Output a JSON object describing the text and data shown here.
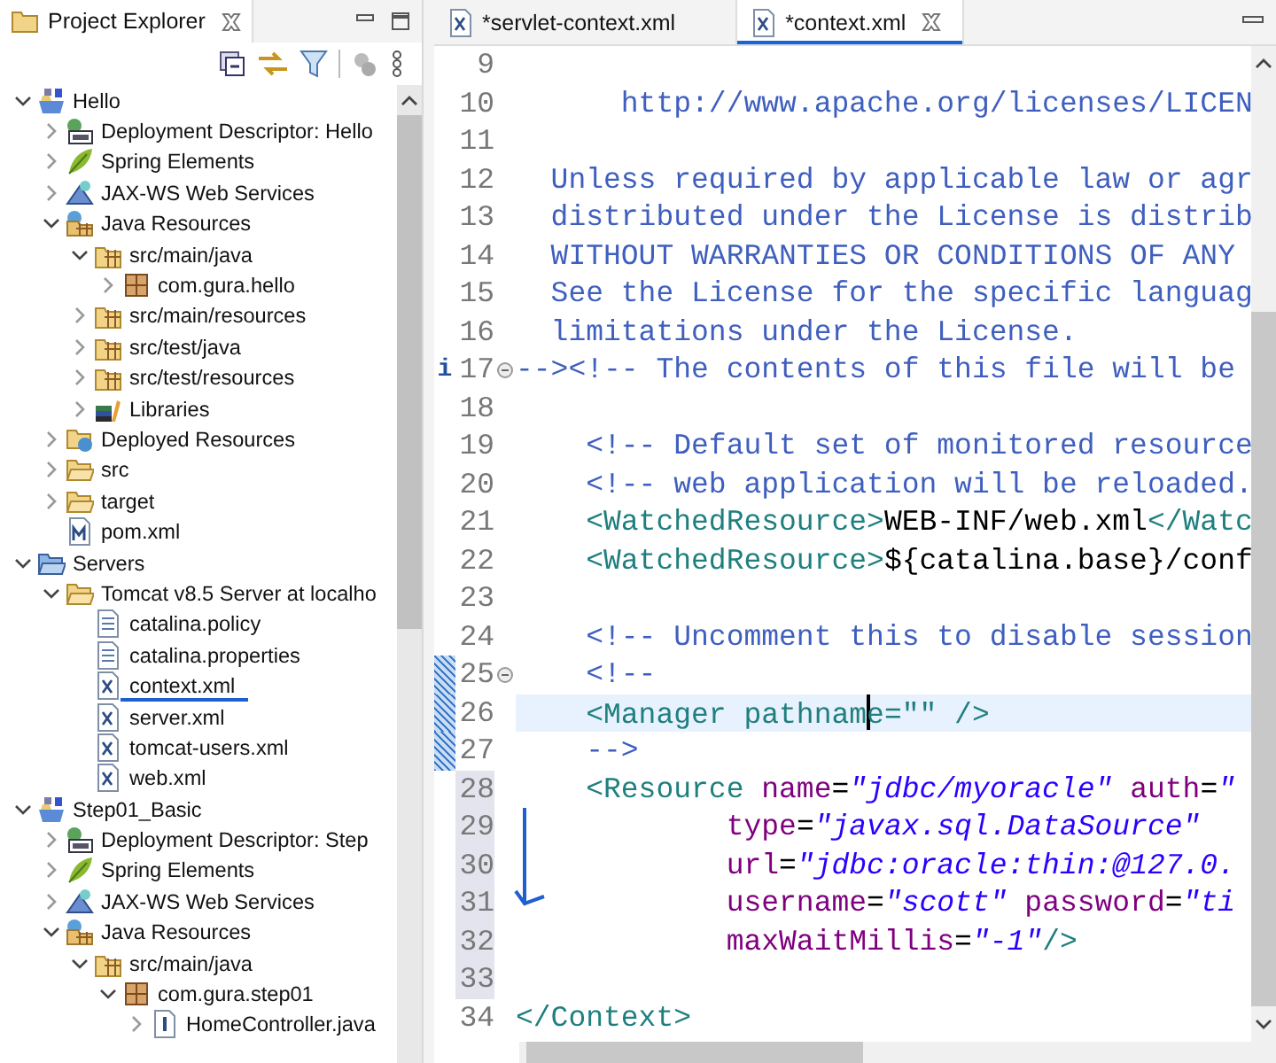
{
  "explorer": {
    "title": "Project Explorer",
    "tree": [
      {
        "label": "Hello",
        "kind": "project",
        "expanded": true,
        "children": [
          {
            "label": "Deployment Descriptor: Hello",
            "kind": "descriptor",
            "expanded": false
          },
          {
            "label": "Spring Elements",
            "kind": "spring",
            "expanded": false
          },
          {
            "label": "JAX-WS Web Services",
            "kind": "webservices",
            "expanded": false
          },
          {
            "label": "Java Resources",
            "kind": "java-resources",
            "expanded": true,
            "children": [
              {
                "label": "src/main/java",
                "kind": "source-folder",
                "expanded": true,
                "children": [
                  {
                    "label": "com.gura.hello",
                    "kind": "package",
                    "expanded": false
                  }
                ]
              },
              {
                "label": "src/main/resources",
                "kind": "source-folder",
                "expanded": false
              },
              {
                "label": "src/test/java",
                "kind": "source-folder",
                "expanded": false
              },
              {
                "label": "src/test/resources",
                "kind": "source-folder",
                "expanded": false
              },
              {
                "label": "Libraries",
                "kind": "libraries",
                "expanded": false
              }
            ]
          },
          {
            "label": "Deployed Resources",
            "kind": "deployed",
            "expanded": false
          },
          {
            "label": "src",
            "kind": "folder",
            "expanded": false
          },
          {
            "label": "target",
            "kind": "folder",
            "expanded": false
          },
          {
            "label": "pom.xml",
            "kind": "maven"
          }
        ]
      },
      {
        "label": "Servers",
        "kind": "servers",
        "expanded": true,
        "children": [
          {
            "label": "Tomcat v8.5 Server at localho",
            "kind": "folder",
            "expanded": true,
            "children": [
              {
                "label": "catalina.policy",
                "kind": "text-file"
              },
              {
                "label": "catalina.properties",
                "kind": "text-file"
              },
              {
                "label": "context.xml",
                "kind": "xml-file",
                "underlined": true
              },
              {
                "label": "server.xml",
                "kind": "xml-file"
              },
              {
                "label": "tomcat-users.xml",
                "kind": "xml-file"
              },
              {
                "label": "web.xml",
                "kind": "xml-file"
              }
            ]
          }
        ]
      },
      {
        "label": "Step01_Basic",
        "kind": "project",
        "expanded": true,
        "children": [
          {
            "label": "Deployment Descriptor: Step",
            "kind": "descriptor",
            "expanded": false
          },
          {
            "label": "Spring Elements",
            "kind": "spring",
            "expanded": false
          },
          {
            "label": "JAX-WS Web Services",
            "kind": "webservices",
            "expanded": false
          },
          {
            "label": "Java Resources",
            "kind": "java-resources",
            "expanded": true,
            "children": [
              {
                "label": "src/main/java",
                "kind": "source-folder",
                "expanded": true,
                "children": [
                  {
                    "label": "com.gura.step01",
                    "kind": "package",
                    "expanded": true,
                    "children": [
                      {
                        "label": "HomeController.java",
                        "kind": "java-file",
                        "expanded": false
                      }
                    ]
                  }
                ]
              }
            ]
          }
        ]
      }
    ]
  },
  "editor": {
    "tabs": [
      {
        "label": "*servlet-context.xml",
        "selected": false
      },
      {
        "label": "*context.xml",
        "selected": true
      }
    ],
    "lines": [
      {
        "number": "9",
        "current": false,
        "changed": false,
        "in_range": false
      },
      {
        "number": "10",
        "tokens": [
          {
            "kind": "comment",
            "text": "      http://www.apache.org/licenses/LICEN"
          }
        ],
        "current": false,
        "changed": false,
        "in_range": false
      },
      {
        "number": "11",
        "current": false,
        "changed": false,
        "in_range": false
      },
      {
        "number": "12",
        "tokens": [
          {
            "kind": "comment",
            "text": "  Unless required by applicable law or agr"
          }
        ],
        "current": false,
        "changed": false,
        "in_range": false
      },
      {
        "number": "13",
        "tokens": [
          {
            "kind": "comment",
            "text": "  distributed under the License is distrib"
          }
        ],
        "current": false,
        "changed": false,
        "in_range": false
      },
      {
        "number": "14",
        "tokens": [
          {
            "kind": "comment",
            "text": "  WITHOUT WARRANTIES OR CONDITIONS OF ANY"
          }
        ],
        "current": false,
        "changed": false,
        "in_range": false
      },
      {
        "number": "15",
        "tokens": [
          {
            "kind": "comment",
            "text": "  See the License for the specific languag"
          }
        ],
        "current": false,
        "changed": false,
        "in_range": false
      },
      {
        "number": "16",
        "tokens": [
          {
            "kind": "comment",
            "text": "  limitations under the License."
          }
        ],
        "current": false,
        "changed": false,
        "in_range": false
      },
      {
        "number": "17",
        "kind": "fold-start",
        "annotation": "i",
        "tokens": [
          {
            "kind": "comment",
            "text": "--><!-- The contents of this file will be"
          }
        ],
        "current": false,
        "changed": false,
        "in_range": false
      },
      {
        "number": "18",
        "current": false,
        "changed": false,
        "in_range": false
      },
      {
        "number": "19",
        "tokens": [
          {
            "kind": "comment",
            "text": "    <!-- Default set of monitored resource"
          }
        ],
        "current": false,
        "changed": false,
        "in_range": false
      },
      {
        "number": "20",
        "tokens": [
          {
            "kind": "comment",
            "text": "    <!-- web application will be reloaded."
          }
        ],
        "current": false,
        "changed": false,
        "in_range": false
      },
      {
        "number": "21",
        "tokens": [
          {
            "kind": "tag",
            "text": "    <WatchedResource>"
          },
          {
            "kind": "plain",
            "text": "WEB-INF/web.xml"
          },
          {
            "kind": "tag",
            "text": "</Watc"
          }
        ],
        "current": false,
        "changed": false,
        "in_range": false
      },
      {
        "number": "22",
        "tokens": [
          {
            "kind": "tag",
            "text": "    <WatchedResource>"
          },
          {
            "kind": "plain",
            "text": "${catalina.base}/conf"
          }
        ],
        "current": false,
        "changed": false,
        "in_range": false
      },
      {
        "number": "23",
        "current": false,
        "changed": false,
        "in_range": false
      },
      {
        "number": "24",
        "tokens": [
          {
            "kind": "comment",
            "text": "    <!-- Uncomment this to disable session"
          }
        ],
        "current": false,
        "changed": false,
        "in_range": false
      },
      {
        "number": "25",
        "kind": "fold-start",
        "tokens": [
          {
            "kind": "comment",
            "text": "    <!--"
          }
        ],
        "current": false,
        "changed": true,
        "in_range": false
      },
      {
        "number": "26",
        "tokens": [
          {
            "kind": "tag",
            "text": "    <Manager pathnam"
          },
          {
            "kind": "caret"
          },
          {
            "kind": "tag",
            "text": "e=\"\" />"
          }
        ],
        "current": true,
        "changed": true,
        "in_range": false
      },
      {
        "number": "27",
        "tokens": [
          {
            "kind": "comment",
            "text": "    -->"
          }
        ],
        "current": false,
        "changed": true,
        "in_range": false
      },
      {
        "number": "28",
        "tokens": [
          {
            "kind": "tag",
            "text": "    <Resource "
          },
          {
            "kind": "attr",
            "text": "name"
          },
          {
            "kind": "plain",
            "text": "="
          },
          {
            "kind": "value",
            "text": "\"jdbc/myoracle\""
          },
          {
            "kind": "attr",
            "text": " auth"
          },
          {
            "kind": "plain",
            "text": "="
          },
          {
            "kind": "value",
            "text": "\""
          }
        ],
        "current": false,
        "changed": false,
        "in_range": true
      },
      {
        "number": "29",
        "tokens": [
          {
            "kind": "attr",
            "text": "            type"
          },
          {
            "kind": "plain",
            "text": "="
          },
          {
            "kind": "value",
            "text": "\"javax.sql.DataSource\""
          }
        ],
        "current": false,
        "changed": false,
        "in_range": true
      },
      {
        "number": "30",
        "tokens": [
          {
            "kind": "attr",
            "text": "            url"
          },
          {
            "kind": "plain",
            "text": "="
          },
          {
            "kind": "value",
            "text": "\"jdbc:oracle:thin:@127.0."
          }
        ],
        "current": false,
        "changed": false,
        "in_range": true
      },
      {
        "number": "31",
        "tokens": [
          {
            "kind": "attr",
            "text": "            username"
          },
          {
            "kind": "plain",
            "text": "="
          },
          {
            "kind": "value",
            "text": "\"scott\""
          },
          {
            "kind": "attr",
            "text": " password"
          },
          {
            "kind": "plain",
            "text": "="
          },
          {
            "kind": "value",
            "text": "\"ti"
          }
        ],
        "current": false,
        "changed": false,
        "in_range": true
      },
      {
        "number": "32",
        "tokens": [
          {
            "kind": "attr",
            "text": "            maxWaitMillis"
          },
          {
            "kind": "plain",
            "text": "="
          },
          {
            "kind": "value",
            "text": "\"-1\""
          },
          {
            "kind": "tag",
            "text": "/>"
          }
        ],
        "current": false,
        "changed": false,
        "in_range": true
      },
      {
        "number": "33",
        "current": false,
        "changed": false,
        "in_range": true
      },
      {
        "number": "34",
        "tokens": [
          {
            "kind": "tag",
            "text": "</Context>"
          }
        ],
        "current": false,
        "changed": false,
        "in_range": false
      }
    ]
  }
}
